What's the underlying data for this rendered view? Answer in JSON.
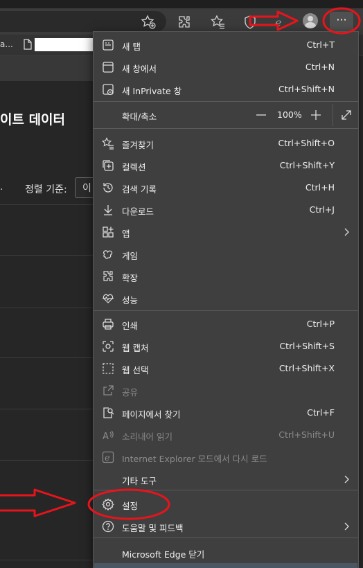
{
  "background_page": {
    "tab_title": "a...",
    "heading": "이트 데이터",
    "sort_label": "정렬 기준:",
    "sort_value": "이",
    "sort_dot": "."
  },
  "toolbar": {
    "icons": [
      "star-add-icon",
      "extensions-icon",
      "favorites-icon",
      "browser-essentials-icon",
      "edge-logo-icon",
      "avatar",
      "more-icon"
    ],
    "more_label": "···"
  },
  "menu": {
    "items": [
      {
        "label": "새 탭",
        "shortcut": "Ctrl+T",
        "icon": "new-tab-icon"
      },
      {
        "label": "새 창에서",
        "shortcut": "Ctrl+N",
        "icon": "new-window-icon"
      },
      {
        "label": "새 InPrivate 창",
        "shortcut": "Ctrl+Shift+N",
        "icon": "inprivate-icon"
      },
      {
        "label": "즐겨찾기",
        "shortcut": "Ctrl+Shift+O",
        "icon": "favorites-icon"
      },
      {
        "label": "컬렉션",
        "shortcut": "Ctrl+Shift+Y",
        "icon": "collections-icon"
      },
      {
        "label": "검색 기록",
        "shortcut": "Ctrl+H",
        "icon": "history-icon"
      },
      {
        "label": "다운로드",
        "shortcut": "Ctrl+J",
        "icon": "download-icon"
      },
      {
        "label": "앱",
        "shortcut": "",
        "icon": "apps-icon"
      },
      {
        "label": "게임",
        "shortcut": "",
        "icon": "games-icon"
      },
      {
        "label": "확장",
        "shortcut": "",
        "icon": "extensions-icon"
      },
      {
        "label": "성능",
        "shortcut": "",
        "icon": "performance-icon"
      },
      {
        "label": "인쇄",
        "shortcut": "Ctrl+P",
        "icon": "print-icon"
      },
      {
        "label": "웹 캡처",
        "shortcut": "Ctrl+Shift+S",
        "icon": "web-capture-icon"
      },
      {
        "label": "웹 선택",
        "shortcut": "Ctrl+Shift+X",
        "icon": "web-select-icon"
      },
      {
        "label": "공유",
        "shortcut": "",
        "icon": "share-icon"
      },
      {
        "label": "페이지에서 찾기",
        "shortcut": "Ctrl+F",
        "icon": "find-icon"
      },
      {
        "label": "소리내어 읽기",
        "shortcut": "Ctrl+Shift+U",
        "icon": "read-aloud-icon"
      },
      {
        "label": "Internet Explorer 모드에서 다시 로드",
        "shortcut": "",
        "icon": "ie-mode-icon"
      },
      {
        "label": "기타 도구",
        "shortcut": "",
        "icon": ""
      },
      {
        "label": "설정",
        "shortcut": "",
        "icon": "settings-icon"
      },
      {
        "label": "도움말 및 피드백",
        "shortcut": "",
        "icon": "help-icon"
      },
      {
        "label": "Microsoft Edge 닫기",
        "shortcut": "",
        "icon": ""
      }
    ],
    "zoom": {
      "label": "확대/축소",
      "value": "100%"
    }
  },
  "colors": {
    "menu_bg": "#3f3f3f",
    "annotation": "#e8141c"
  }
}
